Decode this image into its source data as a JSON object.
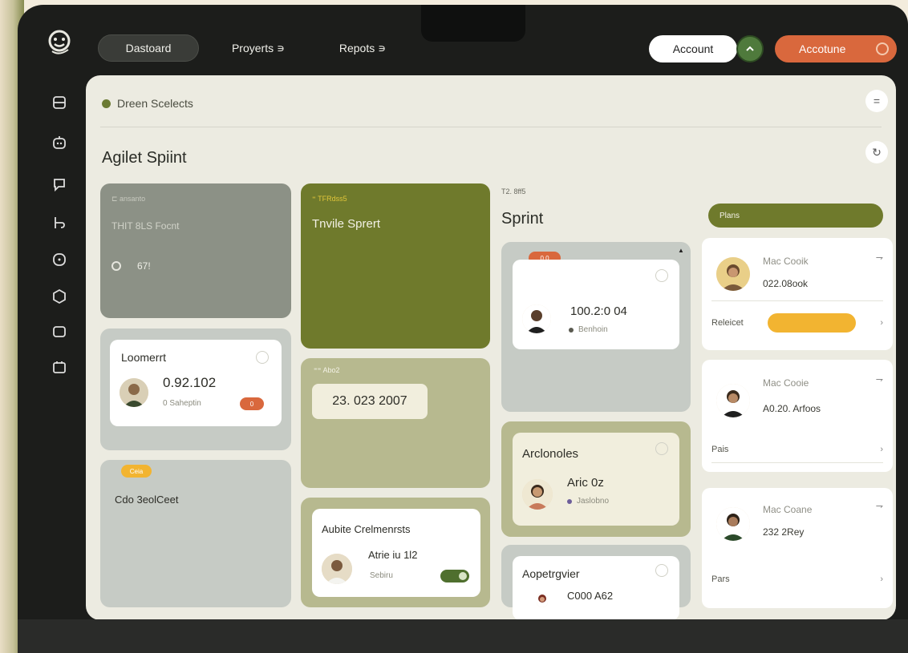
{
  "nav": {
    "dashboard": "Dastoard",
    "projects": "Proyerts ∍",
    "reports": "Repots ∍",
    "account": "Account",
    "accounts": "Accotune"
  },
  "breadcrumb": "Dreen Scelects",
  "page_title": "Agilet Spiint",
  "col1": {
    "tile1": {
      "tag": "⊏ ansanto",
      "title": "THIT 8LS Focnt",
      "count": "67!"
    },
    "card": {
      "title": "Loomerrt",
      "value": "0.92.102",
      "sub": "0 Saheptin",
      "badge": "0"
    },
    "tile3": {
      "badge": "Ceia",
      "title": "Cdo 3eolCeet"
    }
  },
  "col2": {
    "tile1": {
      "tag": "⁼ TFRdss5",
      "title": "Tnvile Sprert"
    },
    "tile2": {
      "tag": "⁼⁼ Abo2",
      "value": "23. 023 2007"
    },
    "card": {
      "title": "Aubite Crelmenrsts",
      "name": "Atrie iu 1l2",
      "sub": "Sebiru"
    }
  },
  "col3": {
    "header_tag": "T2. 8ff5",
    "header_title": "Sprint",
    "card1": {
      "badge": "0.0",
      "value": "100.2:0 04",
      "sub": "Benhoin"
    },
    "card2": {
      "title": "Arclonoles",
      "name": "Aric 0z",
      "sub": "Jaslobno"
    },
    "card3": {
      "title": "Aopetrgvier",
      "value": "C000 A62"
    }
  },
  "col4": {
    "header": "Plans",
    "cards": [
      {
        "name": "Mac Cooik",
        "value": "022.08ook",
        "footer": "Releicet",
        "bar_color": "#f2b431"
      },
      {
        "name": "Mac Cooie",
        "value": "A0.20. Arfoos",
        "footer": "Pais"
      },
      {
        "name": "Mac Coane",
        "value": "232 2Rey",
        "footer": "Pars"
      }
    ]
  },
  "colors": {
    "olive": "#6f7a2c",
    "orange": "#d9683d",
    "yellow": "#f2b431",
    "panel": "#ecebe1"
  },
  "icons": [
    "logo-icon",
    "layers-icon",
    "robot-icon",
    "chat-icon",
    "cursor-icon",
    "clock-icon",
    "hexagon-icon",
    "square-icon",
    "calendar-icon",
    "menu-icon",
    "refresh-icon",
    "heart-icon",
    "chevron-up-icon"
  ]
}
